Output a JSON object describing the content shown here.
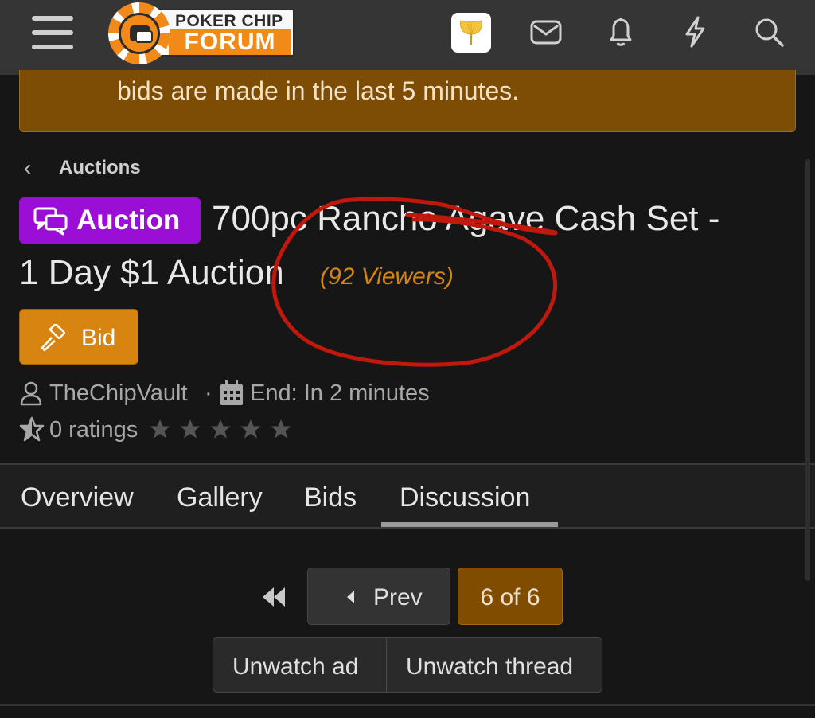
{
  "header": {
    "logo": {
      "top": "POKER CHIP",
      "bottom": "FORUM"
    },
    "icons": [
      "menu-icon",
      "avatar",
      "mail-icon",
      "bell-icon",
      "bolt-icon",
      "search-icon"
    ]
  },
  "notice": {
    "text": "bids are made in the last 5 minutes."
  },
  "breadcrumb": {
    "label": "Auctions"
  },
  "thread": {
    "badge": "Auction",
    "title_line1": "700pc Rancho Agave Cash Set -",
    "title_line2": "1 Day $1 Auction",
    "viewers": "(92 Viewers)"
  },
  "bid_button": {
    "label": "Bid"
  },
  "meta": {
    "author": "TheChipVault",
    "separator": "·",
    "end": "End: In 2 minutes",
    "ratings": "0 ratings",
    "stars": 0
  },
  "tabs": [
    "Overview",
    "Gallery",
    "Bids",
    "Discussion"
  ],
  "active_tab": "Discussion",
  "pager": {
    "prev": "Prev",
    "page": "6 of 6"
  },
  "watch": {
    "ad": "Unwatch ad",
    "thread": "Unwatch thread"
  },
  "colors": {
    "accent_orange": "#d88410",
    "badge_purple": "#9b0ed6",
    "notice_bg": "#7d4d06",
    "annotation_red": "#c0180c"
  }
}
